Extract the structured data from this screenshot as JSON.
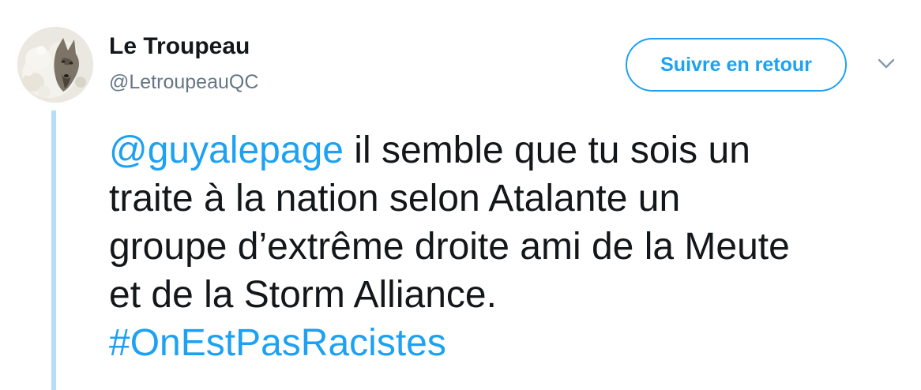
{
  "user": {
    "display_name": "Le Troupeau",
    "screen_name": "@LetroupeauQC",
    "avatar_icon": "avatar-wolf-in-sheep-icon"
  },
  "follow_button": {
    "label": "Suivre en retour"
  },
  "menu": {
    "icon": "chevron-down-icon"
  },
  "tweet": {
    "mention": "@guyalepage",
    "line1_rest": " il semble que tu sois un",
    "line2": "traite à la nation selon Atalante un",
    "line3": "groupe d’extrême droite ami de la Meute",
    "line4": "et de la Storm Alliance.",
    "hashtag": "#OnEstPasRacistes"
  },
  "colors": {
    "accent": "#1da1f2",
    "text": "#14171a",
    "secondary": "#657786",
    "thread_line": "#b8def7"
  }
}
